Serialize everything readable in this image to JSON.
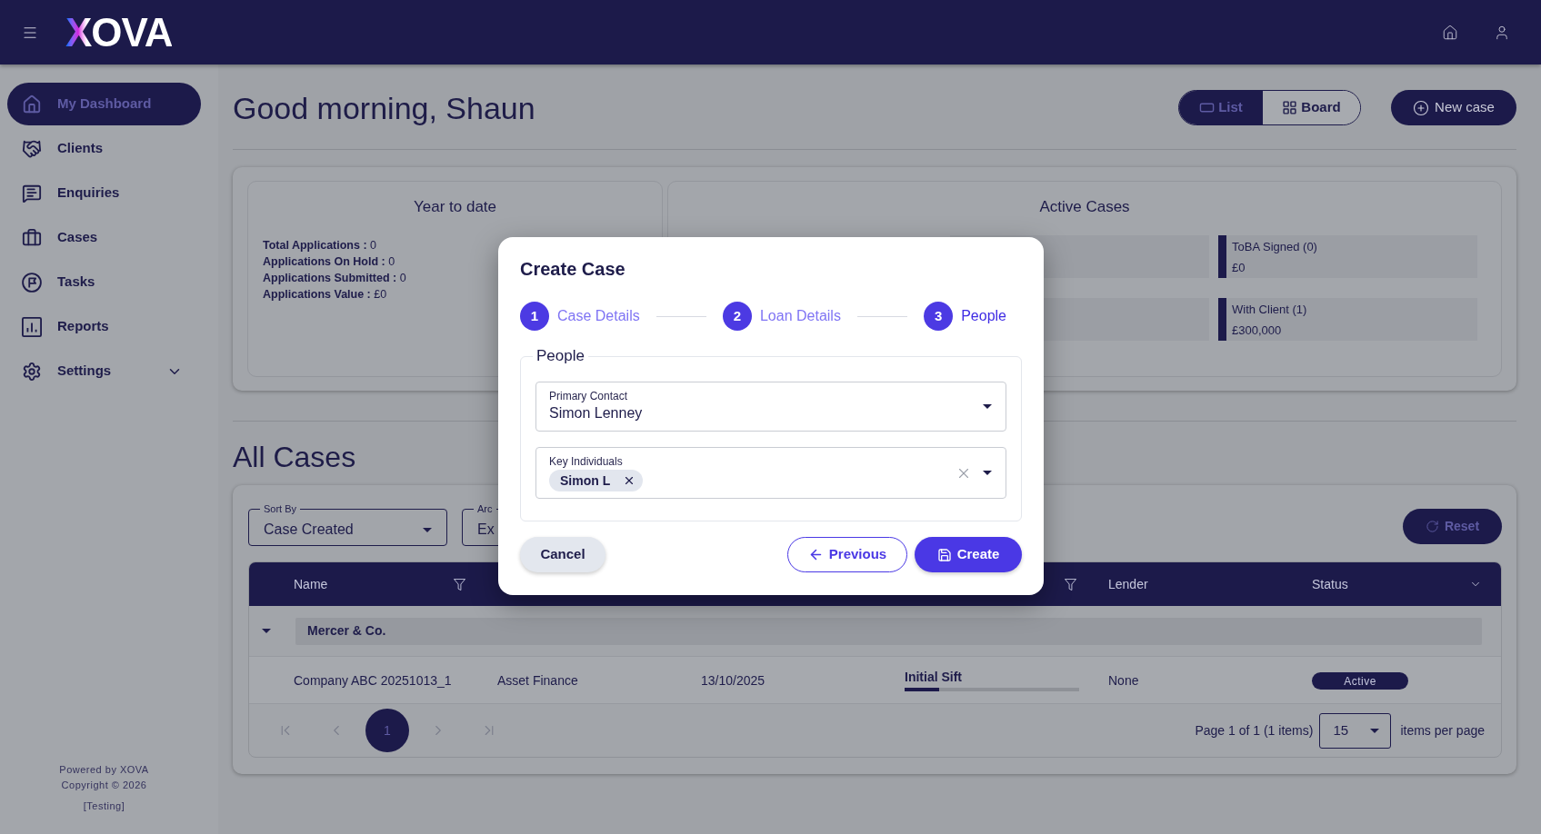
{
  "header": {
    "logo": "XOVA"
  },
  "sidebar": {
    "items": [
      {
        "label": "My Dashboard",
        "kind": "link",
        "selected": true
      },
      {
        "label": "Clients",
        "kind": "link",
        "selected": false
      },
      {
        "label": "Enquiries",
        "kind": "link",
        "selected": false
      },
      {
        "label": "Cases",
        "kind": "link",
        "selected": false
      },
      {
        "label": "Tasks",
        "kind": "link",
        "selected": false
      },
      {
        "label": "Reports",
        "kind": "link",
        "selected": false
      },
      {
        "label": "Settings",
        "kind": "group",
        "selected": false,
        "expanded": false
      }
    ],
    "footer": [
      "Powered by XOVA",
      "Copyright © 2026",
      "[Testing]"
    ]
  },
  "greeting": "Good morning, Shaun",
  "view_toggle": [
    {
      "label": "List",
      "selected": true
    },
    {
      "label": "Board",
      "selected": false
    }
  ],
  "new_case_button": "New case",
  "year_to_date": {
    "title": "Year to date",
    "stats": [
      "**Total Applications :** 0",
      "**Applications On Hold :** 0",
      "**Applications Submitted :** 0",
      "**Applications Value :** £0"
    ]
  },
  "active_cases": {
    "title": "Active Cases",
    "stages": [
      {
        "kind": "covered"
      },
      {
        "kind": "stage",
        "name": "ToBA Signed (0)",
        "amount": "£0"
      },
      {
        "kind": "covered"
      },
      {
        "kind": "stage",
        "name": "With Client (1)",
        "amount": "£300,000"
      }
    ]
  },
  "all_cases": {
    "title": "All Cases",
    "filters": [
      {
        "label": "Sort By",
        "value": "Case Created"
      },
      {
        "label": "Arc",
        "value": "Ex"
      }
    ],
    "reset_button": "Reset",
    "table": {
      "columns": [
        {
          "kind": "header",
          "label": "Name",
          "filter": true
        },
        {
          "kind": "covered"
        },
        {
          "kind": "covered"
        },
        {
          "kind": "header",
          "filter": true
        },
        {
          "kind": "header",
          "label": "Lender",
          "filter": false
        },
        {
          "kind": "header",
          "label": "Status",
          "filter": false
        }
      ],
      "groups": [
        {
          "name": "Mercer & Co.",
          "expanded": true,
          "rows": [
            {
              "cells": [
                {
                  "kind": "text",
                  "text": "Company ABC 20251013_1"
                },
                {
                  "kind": "text",
                  "text": "Asset Finance"
                },
                {
                  "kind": "text",
                  "text": "13/10/2025"
                },
                {
                  "kind": "progress",
                  "text": "Initial Sift",
                  "level": 0.2
                },
                {
                  "kind": "text",
                  "text": "None"
                },
                {
                  "kind": "badge",
                  "text": "Active"
                }
              ]
            }
          ]
        }
      ]
    },
    "pagination": {
      "pages": [
        {
          "label": "1",
          "selected": true
        }
      ],
      "summary": "Page 1 of 1 (1 items)",
      "page_size": "15",
      "page_size_label": "items per page"
    }
  },
  "modal": {
    "title": "Create Case",
    "steps": [
      {
        "number": "1",
        "label": "Case Details",
        "active": false
      },
      {
        "number": "2",
        "label": "Loan Details",
        "active": false
      },
      {
        "number": "3",
        "label": "People",
        "active": true
      }
    ],
    "section": {
      "legend": "People",
      "fields": [
        {
          "kind": "select",
          "label": "Primary Contact",
          "value": "Simon Lenney"
        },
        {
          "kind": "multiselect",
          "label": "Key Individuals",
          "chips": [
            "Simon L"
          ]
        }
      ]
    },
    "buttons": [
      {
        "kind": "cancel",
        "label": "Cancel"
      },
      {
        "kind": "previous",
        "label": "Previous"
      },
      {
        "kind": "create",
        "label": "Create"
      }
    ]
  }
}
